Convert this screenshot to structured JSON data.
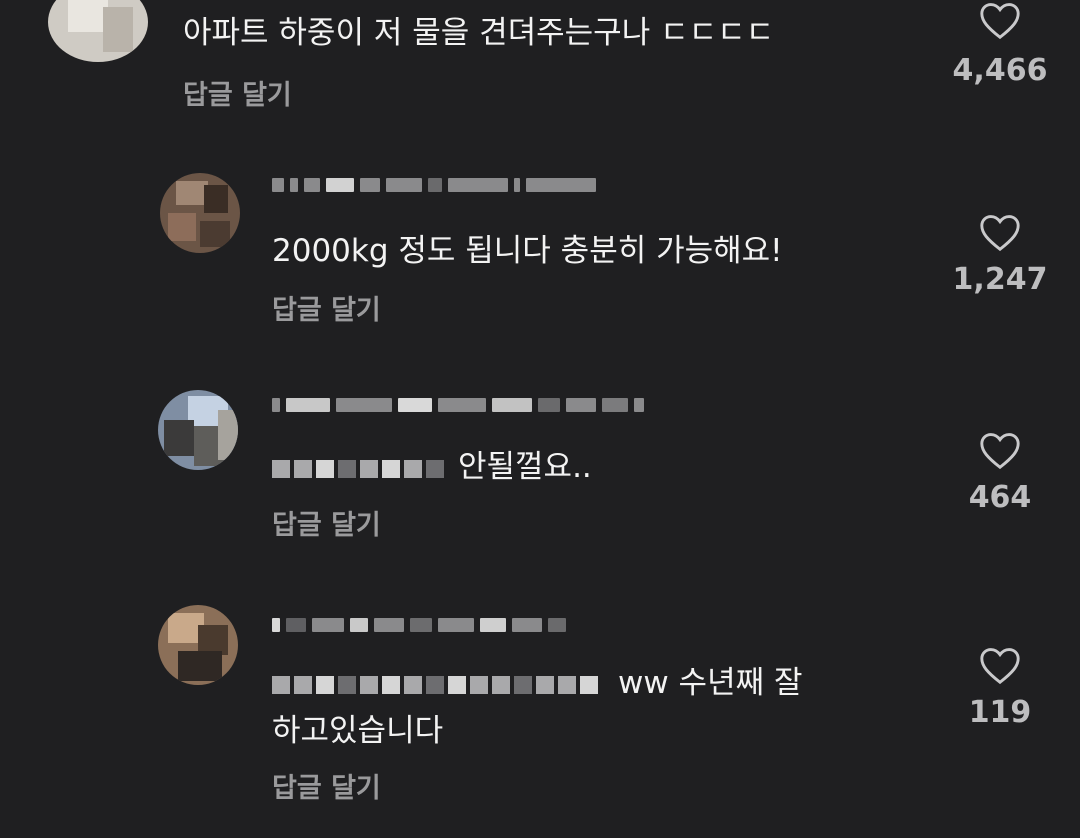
{
  "comments": [
    {
      "text": "아파트 하중이 저 물을 견뎌주는구나 ㄷㄷㄷㄷ",
      "reply_label": "답글 달기",
      "like_count": "4,466",
      "like_icon": "heart-outline-icon"
    },
    {
      "text": "2000kg 정도 됩니다 충분히 가능해요!",
      "reply_label": "답글 달기",
      "like_count": "1,247",
      "like_icon": "heart-outline-icon"
    },
    {
      "text": "안될껄요..",
      "reply_label": "답글 달기",
      "like_count": "464",
      "like_icon": "heart-outline-icon"
    },
    {
      "text": "ww 수년째 잘",
      "text_line2": "하고있습니다",
      "reply_label": "답글 달기",
      "like_count": "119",
      "like_icon": "heart-outline-icon"
    }
  ],
  "colors": {
    "background": "#1f1f21",
    "text": "#f3f3f3",
    "secondary": "#9a9a9c",
    "count": "#bdbdbf"
  }
}
